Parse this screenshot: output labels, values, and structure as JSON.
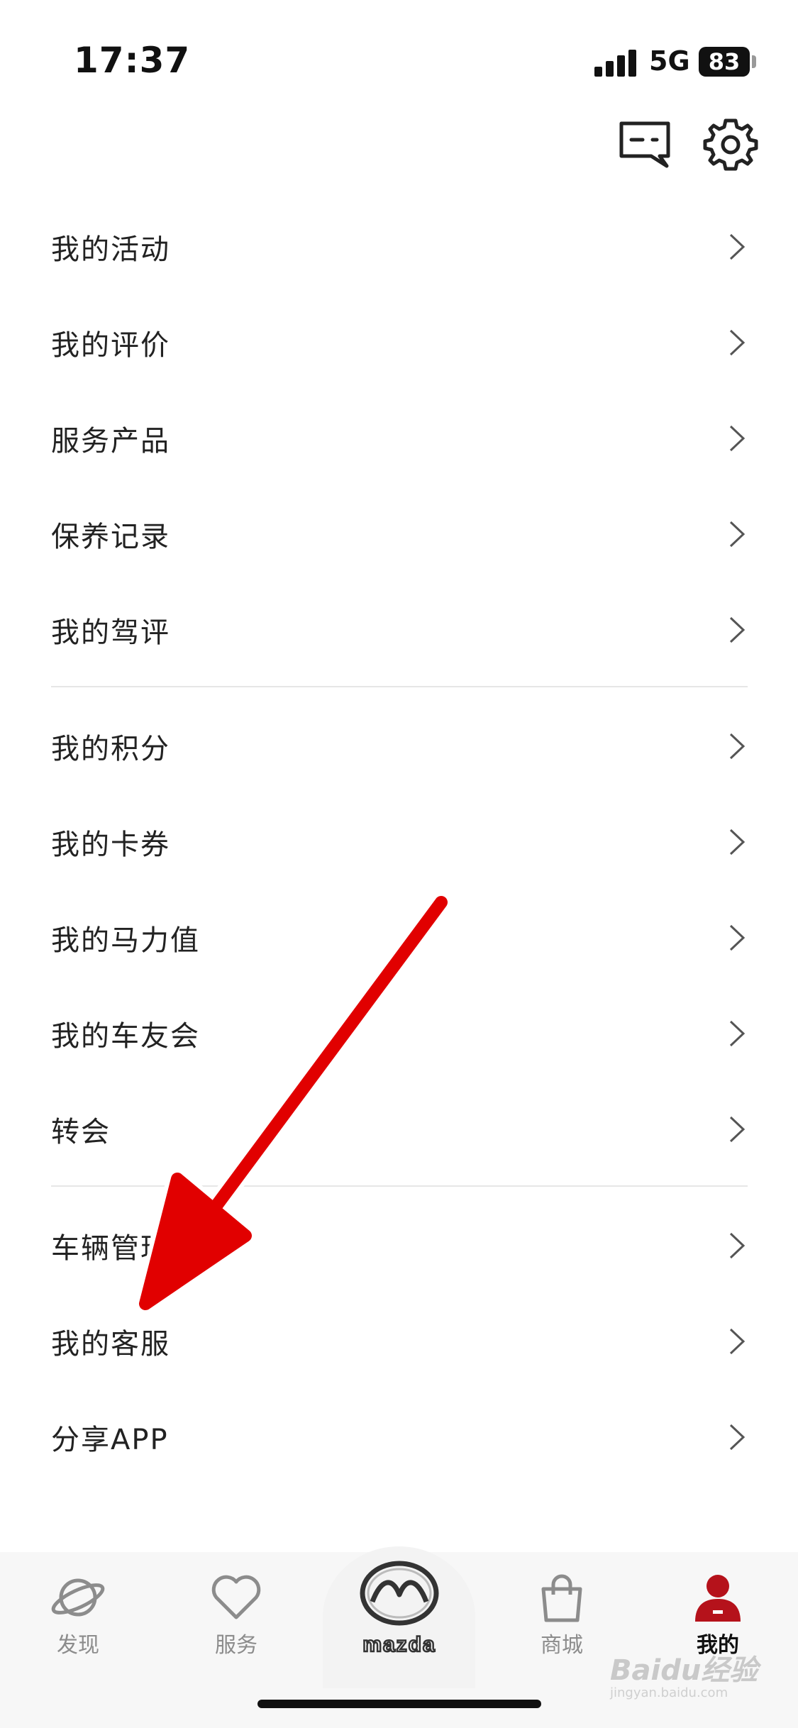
{
  "status_bar": {
    "time": "17:37",
    "network": "5G",
    "battery": "83"
  },
  "header": {
    "message_icon": "message-icon",
    "settings_icon": "gear-icon"
  },
  "menu": {
    "group1": [
      {
        "label": "我的活动"
      },
      {
        "label": "我的评价"
      },
      {
        "label": "服务产品"
      },
      {
        "label": "保养记录"
      },
      {
        "label": "我的驾评"
      }
    ],
    "group2": [
      {
        "label": "我的积分"
      },
      {
        "label": "我的卡券"
      },
      {
        "label": "我的马力值"
      },
      {
        "label": "我的车友会"
      },
      {
        "label": "转会"
      }
    ],
    "group3": [
      {
        "label": "车辆管理"
      },
      {
        "label": "我的客服"
      },
      {
        "label": "分享APP"
      }
    ]
  },
  "tab_bar": {
    "tabs": [
      {
        "label": "发现",
        "icon": "planet-icon"
      },
      {
        "label": "服务",
        "icon": "heart-icon"
      },
      {
        "label": "",
        "icon": "mazda-logo-icon"
      },
      {
        "label": "商城",
        "icon": "shopping-bag-icon"
      },
      {
        "label": "我的",
        "icon": "user-icon"
      }
    ],
    "brand_word": "mazda",
    "active_color": "#b5121b"
  },
  "watermark": {
    "text": "Baidu经验",
    "sub": "jingyan.baidu.com"
  }
}
